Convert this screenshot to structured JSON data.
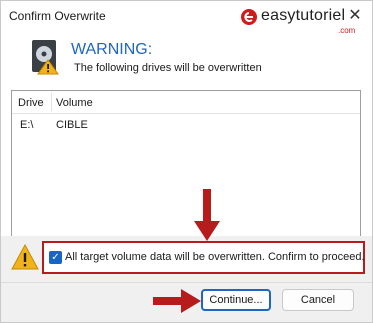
{
  "window": {
    "title": "Confirm Overwrite",
    "close_label": "✕"
  },
  "watermark": {
    "prefix": "e",
    "main": "easytutoriel",
    "suffix": ".com"
  },
  "dialog": {
    "heading": "WARNING:",
    "subtext": "The following drives will be overwritten",
    "drive_icon": "drive-warning-icon"
  },
  "list": {
    "columns": [
      "Drive",
      "Volume"
    ],
    "rows": [
      {
        "drive": "E:\\",
        "volume": "CIBLE"
      }
    ]
  },
  "confirm": {
    "checked": true,
    "label": "All target volume data will be overwritten. Confirm to proceed.",
    "icon": "warning-triangle-icon"
  },
  "buttons": {
    "continue": "Continue...",
    "cancel": "Cancel"
  },
  "colors": {
    "heading": "#1e66c0",
    "highlight_box": "#b71c1c",
    "annotation_arrow": "#b71c1c",
    "checkbox": "#1666c5"
  }
}
